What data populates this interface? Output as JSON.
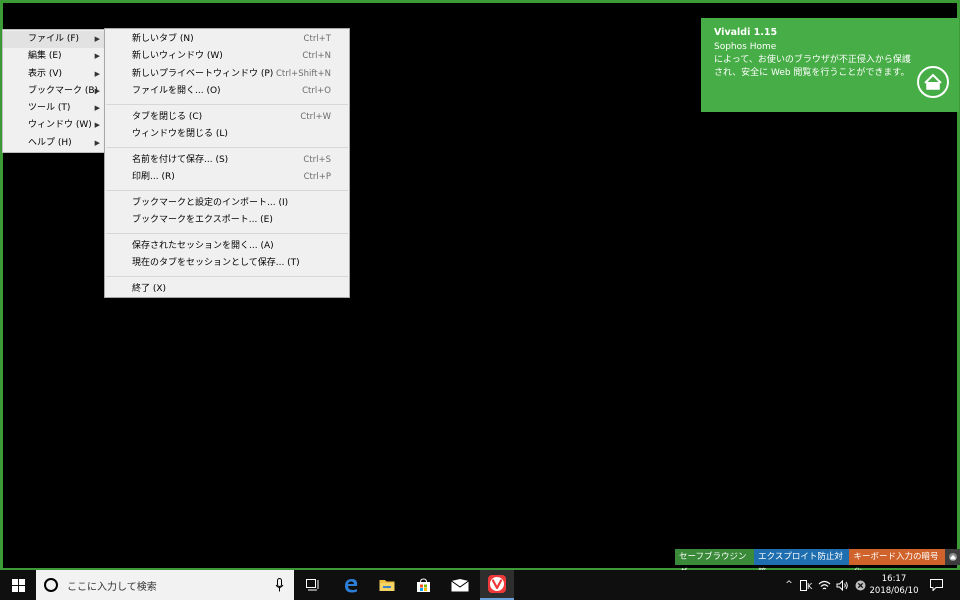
{
  "main_menu": {
    "items": [
      {
        "label": "ファイル (F)",
        "active": true
      },
      {
        "label": "編集 (E)"
      },
      {
        "label": "表示 (V)"
      },
      {
        "label": "ブックマーク (B)"
      },
      {
        "label": "ツール (T)"
      },
      {
        "label": "ウィンドウ (W)"
      },
      {
        "label": "ヘルプ (H)"
      }
    ]
  },
  "file_menu": {
    "groups": [
      [
        {
          "label": "新しいタブ (N)",
          "shortcut": "Ctrl+T"
        },
        {
          "label": "新しいウィンドウ (W)",
          "shortcut": "Ctrl+N"
        },
        {
          "label": "新しいプライベートウィンドウ (P)",
          "shortcut": "Ctrl+Shift+N"
        },
        {
          "label": "ファイルを開く... (O)",
          "shortcut": "Ctrl+O"
        }
      ],
      [
        {
          "label": "タブを閉じる (C)",
          "shortcut": "Ctrl+W"
        },
        {
          "label": "ウィンドウを閉じる (L)",
          "shortcut": ""
        }
      ],
      [
        {
          "label": "名前を付けて保存... (S)",
          "shortcut": "Ctrl+S"
        },
        {
          "label": "印刷... (R)",
          "shortcut": "Ctrl+P"
        }
      ],
      [
        {
          "label": "ブックマークと設定のインポート... (I)",
          "shortcut": ""
        },
        {
          "label": "ブックマークをエクスポート... (E)",
          "shortcut": ""
        }
      ],
      [
        {
          "label": "保存されたセッションを開く... (A)",
          "shortcut": ""
        },
        {
          "label": "現在のタブをセッションとして保存... (T)",
          "shortcut": ""
        }
      ],
      [
        {
          "label": "終了 (X)",
          "shortcut": ""
        }
      ]
    ]
  },
  "notification": {
    "title": "Vivaldi 1.15",
    "subtitle": "Sophos Home",
    "message": "によって、お使いのブラウザが不正侵入から保護され、安全に Web 閲覧を行うことができます。",
    "bg_color": "#47ad46",
    "icon": "home-icon"
  },
  "status_bar": {
    "segments": [
      {
        "label": "セーフブラウジング",
        "color": "#3a8a3a"
      },
      {
        "label": "エクスプロイト防止対策",
        "color": "#1f6fb0"
      },
      {
        "label": "キーボード入力の暗号化",
        "color": "#d0632c"
      }
    ],
    "icon": "shield-icon"
  },
  "taskbar": {
    "search_placeholder": "ここに入力して検索",
    "time": "16:17",
    "date": "2018/06/10",
    "apps": [
      "task-view-icon",
      "edge-icon",
      "file-explorer-icon",
      "store-icon",
      "mail-icon",
      "vivaldi-icon"
    ]
  }
}
